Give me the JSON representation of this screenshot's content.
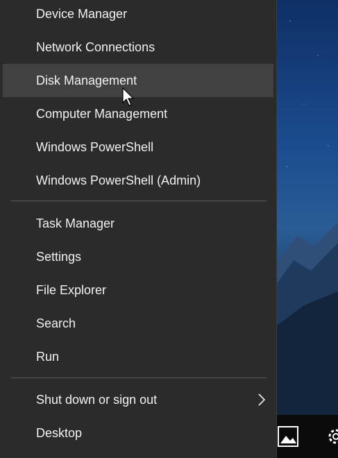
{
  "menu": {
    "items_group1": [
      {
        "label": "Device Manager",
        "name": "menu-item-device-manager"
      },
      {
        "label": "Network Connections",
        "name": "menu-item-network-connections"
      },
      {
        "label": "Disk Management",
        "name": "menu-item-disk-management",
        "hover": true
      },
      {
        "label": "Computer Management",
        "name": "menu-item-computer-management"
      },
      {
        "label": "Windows PowerShell",
        "name": "menu-item-windows-powershell"
      },
      {
        "label": "Windows PowerShell (Admin)",
        "name": "menu-item-windows-powershell-admin"
      }
    ],
    "items_group2": [
      {
        "label": "Task Manager",
        "name": "menu-item-task-manager"
      },
      {
        "label": "Settings",
        "name": "menu-item-settings"
      },
      {
        "label": "File Explorer",
        "name": "menu-item-file-explorer"
      },
      {
        "label": "Search",
        "name": "menu-item-search"
      },
      {
        "label": "Run",
        "name": "menu-item-run"
      }
    ],
    "items_group3": [
      {
        "label": "Shut down or sign out",
        "name": "menu-item-shut-down-or-sign-out",
        "submenu": true
      },
      {
        "label": "Desktop",
        "name": "menu-item-desktop"
      }
    ]
  },
  "colors": {
    "menu_background": "#2b2b2b",
    "hover_background": "#414141",
    "text": "#f2f2f2",
    "separator": "#5a5a5a"
  },
  "icons": {
    "submenu": "chevron-right-icon",
    "cursor": "mouse-pointer-icon",
    "taskbar_photos": "photos-icon",
    "taskbar_settings": "gear-icon"
  }
}
